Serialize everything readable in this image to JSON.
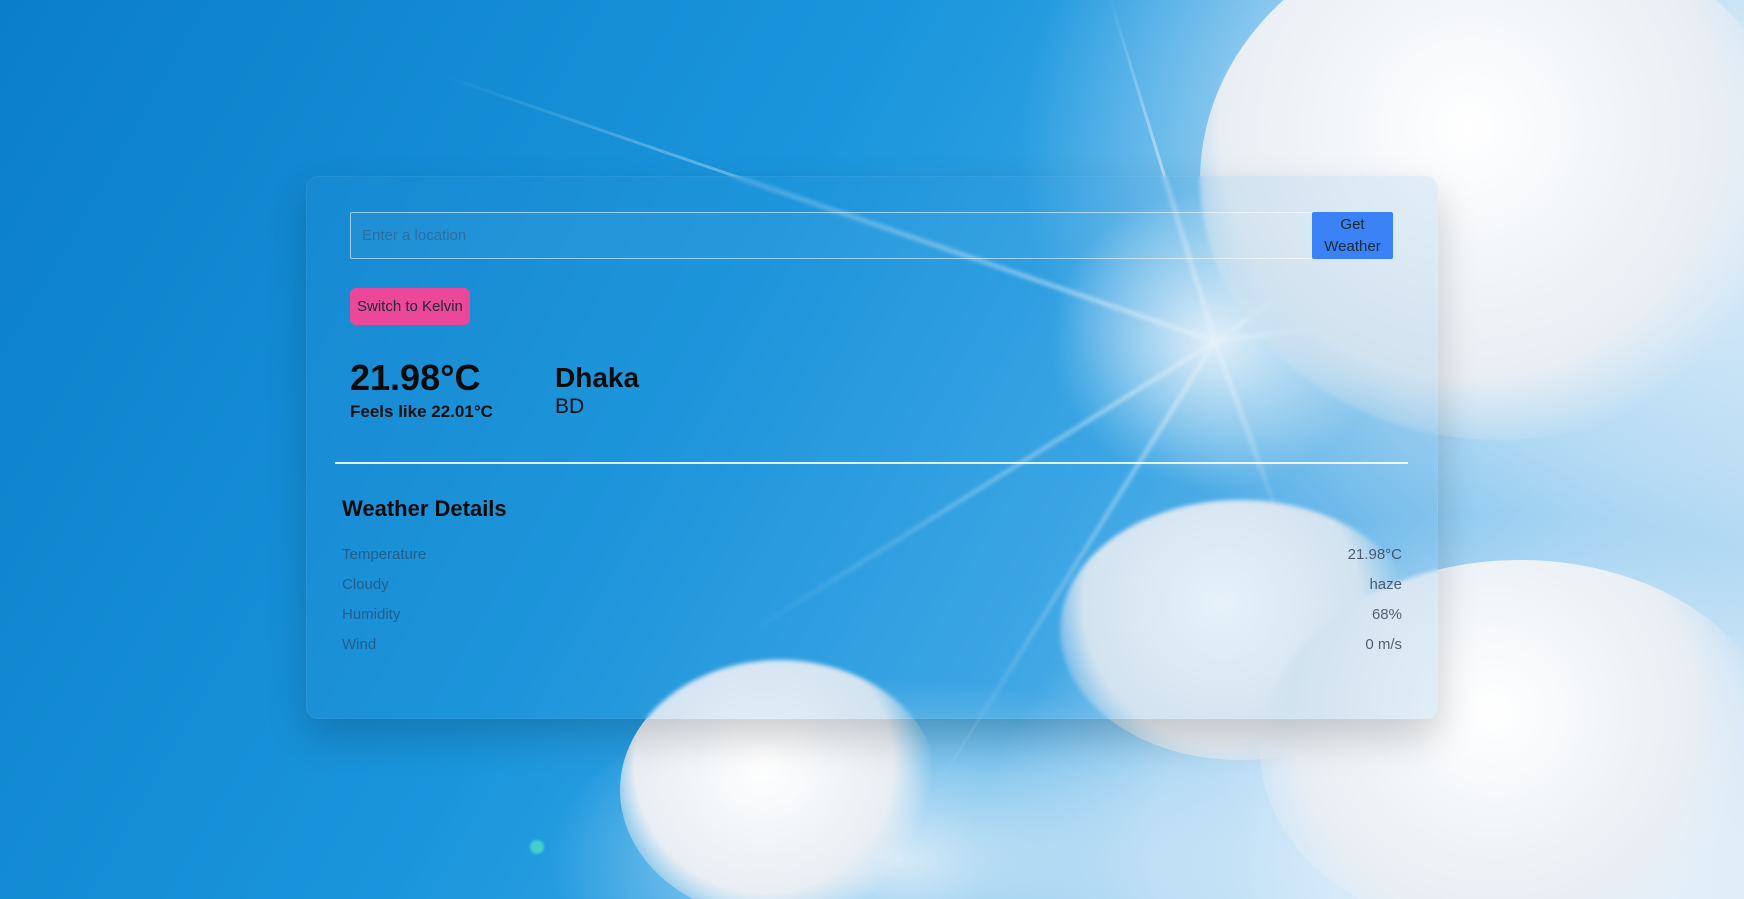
{
  "search": {
    "placeholder": "Enter a location",
    "value": "",
    "button_label": "Get Weather"
  },
  "unit_toggle": {
    "label": "Switch to Kelvin"
  },
  "current": {
    "temperature": "21.98°C",
    "feels_like": "Feels like 22.01°C",
    "city": "Dhaka",
    "country": "BD"
  },
  "details": {
    "title": "Weather Details",
    "rows": [
      {
        "label": "Temperature",
        "value": "21.98°C"
      },
      {
        "label": "Cloudy",
        "value": "haze"
      },
      {
        "label": "Humidity",
        "value": "68%"
      },
      {
        "label": "Wind",
        "value": "0 m/s"
      }
    ]
  },
  "colors": {
    "primary_button": "#3b82f6",
    "toggle_button": "#ec4899",
    "sky": "#0d8fd6"
  }
}
